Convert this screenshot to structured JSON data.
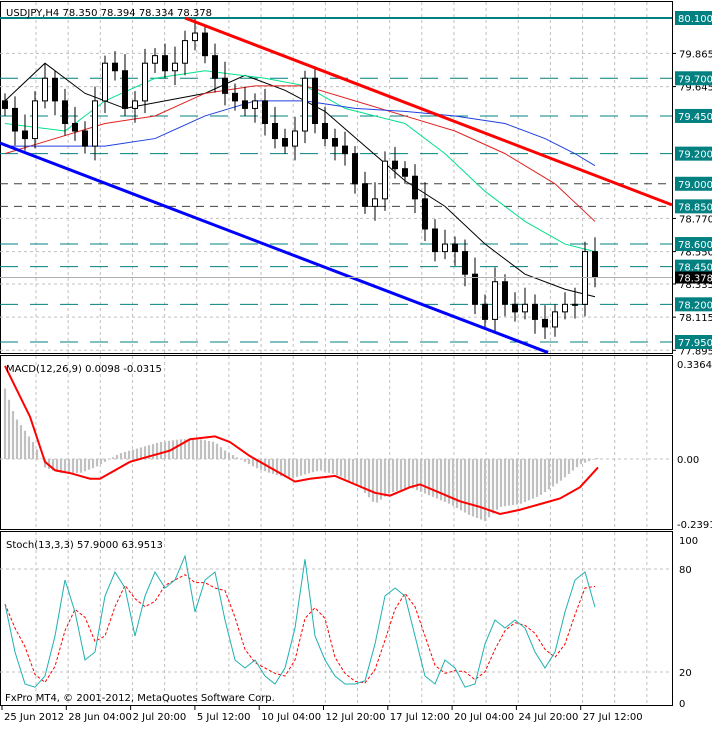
{
  "header": {
    "symbol_label": "USDJPY,H4  78.350 78.394 78.334 78.378"
  },
  "copyright": "FxPro MT4, © 2001-2012, MetaQuotes Software Corp.",
  "colors": {
    "teal": "#008080",
    "trend_red": "#ff0000",
    "trend_blue": "#0000ff",
    "ma_black": "#000000",
    "ma_green": "#00e08a",
    "ma_red": "#e02020",
    "ma_blue": "#2040e0",
    "stoch_main": "#20b0b0",
    "stoch_signal": "#ff0000",
    "macd_hist": "#c0c0c0"
  },
  "chart_data": [
    {
      "type": "candlestick",
      "title": "USDJPY,H4",
      "ylim": [
        77.86,
        80.2
      ],
      "price_axis_labels": [
        "79.865",
        "79.645",
        "78.770",
        "78.550",
        "78.335",
        "78.115",
        "77.895"
      ],
      "current_price": "78.378",
      "levels": [
        {
          "label": "80.100",
          "value": 80.1,
          "style": "solid"
        },
        {
          "label": "79.700",
          "value": 79.7,
          "style": "dash"
        },
        {
          "label": "79.450",
          "value": 79.45,
          "style": "dash"
        },
        {
          "label": "79.200",
          "value": 79.2,
          "style": "dash"
        },
        {
          "label": "79.000",
          "value": 79.0,
          "style": "dashdark"
        },
        {
          "label": "78.850",
          "value": 78.85,
          "style": "dashdark"
        },
        {
          "label": "78.600",
          "value": 78.6,
          "style": "dash"
        },
        {
          "label": "78.450",
          "value": 78.45,
          "style": "dash"
        },
        {
          "label": "78.200",
          "value": 78.2,
          "style": "dash"
        },
        {
          "label": "77.950",
          "value": 77.95,
          "style": "dash"
        }
      ],
      "closes": [
        79.5,
        79.35,
        79.3,
        79.55,
        79.7,
        79.55,
        79.4,
        79.35,
        79.25,
        79.55,
        79.8,
        79.75,
        79.5,
        79.55,
        79.8,
        79.85,
        79.75,
        79.8,
        79.95,
        80.0,
        79.85,
        79.7,
        79.6,
        79.55,
        79.5,
        79.55,
        79.4,
        79.3,
        79.25,
        79.35,
        79.7,
        79.4,
        79.3,
        79.25,
        79.2,
        79.0,
        78.85,
        78.9,
        79.15,
        79.1,
        79.05,
        78.9,
        78.7,
        78.55,
        78.6,
        78.55,
        78.4,
        78.2,
        78.1,
        78.35,
        78.2,
        78.15,
        78.2,
        78.1,
        78.05,
        78.15,
        78.2,
        78.2,
        78.55,
        78.378
      ],
      "moving_averages": [
        {
          "name": "black",
          "points": [
            [
              0,
              79.55
            ],
            [
              4,
              79.8
            ],
            [
              8,
              79.6
            ],
            [
              12,
              79.5
            ],
            [
              16,
              79.55
            ],
            [
              20,
              79.6
            ],
            [
              24,
              79.72
            ],
            [
              28,
              79.62
            ],
            [
              32,
              79.48
            ],
            [
              36,
              79.25
            ],
            [
              40,
              79.02
            ],
            [
              44,
              78.85
            ],
            [
              48,
              78.6
            ],
            [
              52,
              78.4
            ],
            [
              56,
              78.3
            ],
            [
              59,
              78.25
            ]
          ]
        },
        {
          "name": "green",
          "points": [
            [
              0,
              79.4
            ],
            [
              6,
              79.35
            ],
            [
              10,
              79.55
            ],
            [
              15,
              79.7
            ],
            [
              20,
              79.75
            ],
            [
              26,
              79.7
            ],
            [
              30,
              79.65
            ],
            [
              34,
              79.5
            ],
            [
              40,
              79.4
            ],
            [
              44,
              79.2
            ],
            [
              48,
              78.95
            ],
            [
              52,
              78.75
            ],
            [
              56,
              78.6
            ],
            [
              59,
              78.55
            ]
          ]
        },
        {
          "name": "red",
          "points": [
            [
              0,
              79.2
            ],
            [
              5,
              79.3
            ],
            [
              10,
              79.4
            ],
            [
              15,
              79.45
            ],
            [
              20,
              79.6
            ],
            [
              25,
              79.65
            ],
            [
              30,
              79.65
            ],
            [
              35,
              79.55
            ],
            [
              40,
              79.45
            ],
            [
              45,
              79.35
            ],
            [
              50,
              79.2
            ],
            [
              55,
              79.0
            ],
            [
              59,
              78.75
            ]
          ]
        },
        {
          "name": "blue",
          "points": [
            [
              0,
              79.25
            ],
            [
              5,
              79.25
            ],
            [
              10,
              79.25
            ],
            [
              15,
              79.3
            ],
            [
              20,
              79.45
            ],
            [
              25,
              79.55
            ],
            [
              30,
              79.55
            ],
            [
              35,
              79.5
            ],
            [
              40,
              79.48
            ],
            [
              45,
              79.45
            ],
            [
              50,
              79.4
            ],
            [
              54,
              79.3
            ],
            [
              57,
              79.2
            ],
            [
              59,
              79.12
            ]
          ]
        }
      ],
      "trendlines": [
        {
          "name": "resistance",
          "color": "red",
          "from": [
            18,
            80.1
          ],
          "to": [
            66.7,
            78.86
          ]
        },
        {
          "name": "support",
          "color": "blue",
          "from": [
            -0.5,
            79.27
          ],
          "to": [
            54.3,
            77.88
          ]
        }
      ],
      "x_tick_labels": [
        "25 Jun 2012",
        "28 Jun 04:00",
        "2 Jul 20:00",
        "5 Jul 12:00",
        "10 Jul 04:00",
        "12 Jul 20:00",
        "17 Jul 12:00",
        "20 Jul 04:00",
        "24 Jul 20:00",
        "27 Jul 12:00"
      ]
    },
    {
      "type": "bar+line",
      "title": "MACD(12,26,9) 0.0098 -0.0315",
      "ylim": [
        -0.2391,
        0.3364
      ],
      "axis_labels": [
        "0.3364",
        "0.00",
        "-0.2391"
      ],
      "histogram": [
        [
          0,
          0.25
        ],
        [
          1,
          0.15
        ],
        [
          2,
          0.1
        ],
        [
          3,
          0.05
        ],
        [
          4,
          -0.03
        ],
        [
          5.5,
          -0.05
        ],
        [
          7.5,
          -0.05
        ],
        [
          9,
          -0.03
        ],
        [
          10.5,
          0.0
        ],
        [
          11.5,
          0.02
        ],
        [
          13.5,
          0.04
        ],
        [
          15.5,
          0.06
        ],
        [
          17.5,
          0.07
        ],
        [
          19.5,
          0.07
        ],
        [
          21,
          0.06
        ],
        [
          22,
          0.03
        ],
        [
          23.5,
          0.0
        ],
        [
          25,
          -0.03
        ],
        [
          26.5,
          -0.05
        ],
        [
          28.5,
          -0.07
        ],
        [
          29.5,
          -0.06
        ],
        [
          31.5,
          -0.04
        ],
        [
          33.5,
          -0.06
        ],
        [
          35.5,
          -0.1
        ],
        [
          37,
          -0.16
        ],
        [
          38.5,
          -0.12
        ],
        [
          40.5,
          -0.1
        ],
        [
          42.5,
          -0.13
        ],
        [
          44.5,
          -0.16
        ],
        [
          46.5,
          -0.2
        ],
        [
          48,
          -0.22
        ],
        [
          49.5,
          -0.17
        ],
        [
          51.5,
          -0.16
        ],
        [
          53.5,
          -0.13
        ],
        [
          55.5,
          -0.08
        ],
        [
          57.5,
          -0.02
        ],
        [
          59.3,
          0.005
        ]
      ],
      "signal": [
        [
          0,
          0.33
        ],
        [
          2.5,
          0.15
        ],
        [
          4,
          -0.01
        ],
        [
          5,
          -0.04
        ],
        [
          6.5,
          -0.05
        ],
        [
          8.5,
          -0.07
        ],
        [
          9.5,
          -0.07
        ],
        [
          10.5,
          -0.05
        ],
        [
          12.5,
          -0.01
        ],
        [
          14.5,
          0.01
        ],
        [
          16.5,
          0.03
        ],
        [
          18.5,
          0.07
        ],
        [
          21,
          0.08
        ],
        [
          22.5,
          0.06
        ],
        [
          24.5,
          0.01
        ],
        [
          26.5,
          -0.03
        ],
        [
          29,
          -0.08
        ],
        [
          30.5,
          -0.07
        ],
        [
          33,
          -0.06
        ],
        [
          35,
          -0.09
        ],
        [
          37,
          -0.12
        ],
        [
          38.5,
          -0.13
        ],
        [
          40.5,
          -0.1
        ],
        [
          41.5,
          -0.09
        ],
        [
          43.5,
          -0.12
        ],
        [
          45.5,
          -0.15
        ],
        [
          47.5,
          -0.17
        ],
        [
          49.5,
          -0.195
        ],
        [
          51.5,
          -0.18
        ],
        [
          53.5,
          -0.16
        ],
        [
          55.5,
          -0.14
        ],
        [
          57.5,
          -0.1
        ],
        [
          59.3,
          -0.03
        ]
      ]
    },
    {
      "type": "line",
      "title": "Stoch(13,3,3) 57.9000 63.9513",
      "ylim": [
        0,
        100
      ],
      "axis_labels": [
        "100",
        "80",
        "20",
        "0"
      ],
      "main": [
        60,
        30,
        10,
        8,
        15,
        40,
        75,
        55,
        25,
        30,
        65,
        80,
        70,
        40,
        65,
        80,
        70,
        75,
        90,
        55,
        75,
        80,
        50,
        25,
        20,
        25,
        15,
        10,
        20,
        45,
        88,
        40,
        25,
        15,
        10,
        10,
        12,
        35,
        65,
        70,
        65,
        40,
        15,
        10,
        25,
        20,
        8,
        10,
        35,
        50,
        45,
        50,
        45,
        30,
        20,
        30,
        55,
        75,
        80,
        58
      ],
      "signal_period": 3
    }
  ]
}
